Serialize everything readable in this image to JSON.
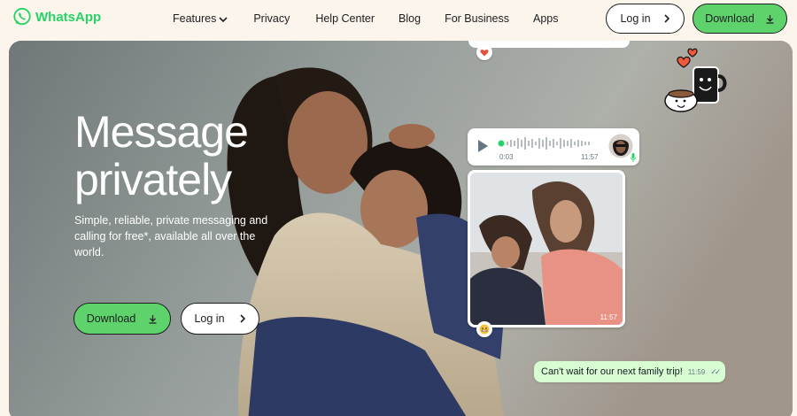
{
  "brand": {
    "name": "WhatsApp",
    "color": "#25d366"
  },
  "nav": {
    "items": [
      {
        "label": "Features",
        "has_dropdown": true
      },
      {
        "label": "Privacy"
      },
      {
        "label": "Help Center"
      },
      {
        "label": "Blog"
      },
      {
        "label": "For Business"
      },
      {
        "label": "Apps"
      }
    ],
    "login_label": "Log in",
    "download_label": "Download"
  },
  "hero": {
    "headline_line1": "Message",
    "headline_line2": "privately",
    "subtext": "Simple, reliable, private messaging and calling for free*, available all over the world.",
    "download_label": "Download",
    "login_label": "Log in"
  },
  "chat": {
    "voice_message": {
      "elapsed": "0:03",
      "time": "11:57"
    },
    "photo_message": {
      "time": "11:57"
    },
    "text_message": {
      "text": "Can't wait for our next family trip!",
      "time": "11:59"
    },
    "reactions": [
      "heart",
      "grin"
    ]
  },
  "colors": {
    "accent_button": "#5ed36b",
    "bubble_outgoing": "#d9fdd3",
    "page_bg": "#fcf5eb"
  }
}
